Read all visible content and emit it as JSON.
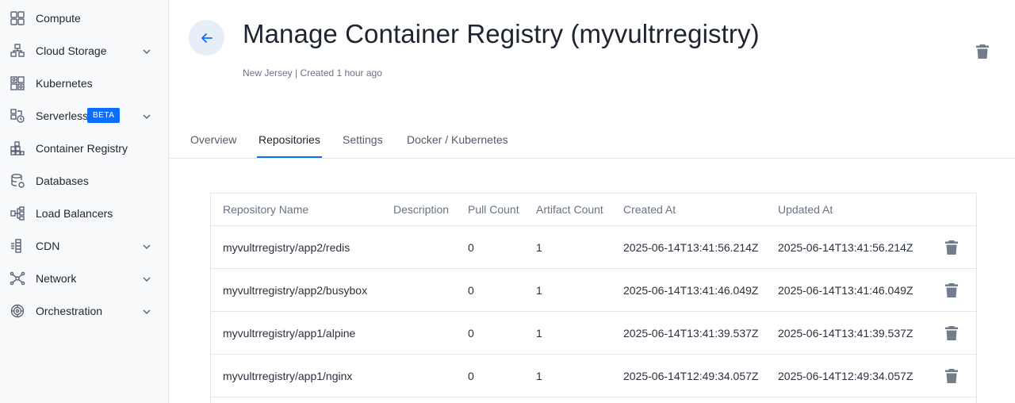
{
  "sidebar": {
    "items": [
      {
        "label": "Compute",
        "icon": "compute-icon",
        "expandable": false
      },
      {
        "label": "Cloud Storage",
        "icon": "cloud-storage-icon",
        "expandable": true
      },
      {
        "label": "Kubernetes",
        "icon": "kubernetes-icon",
        "expandable": false
      },
      {
        "label": "Serverless",
        "icon": "serverless-icon",
        "expandable": true,
        "badge": "BETA"
      },
      {
        "label": "Container Registry",
        "icon": "container-registry-icon",
        "expandable": false
      },
      {
        "label": "Databases",
        "icon": "databases-icon",
        "expandable": false
      },
      {
        "label": "Load Balancers",
        "icon": "load-balancers-icon",
        "expandable": false
      },
      {
        "label": "CDN",
        "icon": "cdn-icon",
        "expandable": true
      },
      {
        "label": "Network",
        "icon": "network-icon",
        "expandable": true
      },
      {
        "label": "Orchestration",
        "icon": "orchestration-icon",
        "expandable": true
      }
    ]
  },
  "header": {
    "title": "Manage Container Registry (myvultrregistry)",
    "subtitle": "New Jersey | Created 1 hour ago",
    "back_icon": "arrow-left-icon",
    "delete_icon": "trash-icon"
  },
  "tabs": [
    {
      "label": "Overview",
      "active": false
    },
    {
      "label": "Repositories",
      "active": true
    },
    {
      "label": "Settings",
      "active": false
    },
    {
      "label": "Docker / Kubernetes",
      "active": false
    }
  ],
  "table": {
    "columns": [
      "Repository Name",
      "Description",
      "Pull Count",
      "Artifact Count",
      "Created At",
      "Updated At"
    ],
    "rows": [
      {
        "name": "myvultrregistry/app2/redis",
        "description": "",
        "pull_count": "0",
        "artifact_count": "1",
        "created_at": "2025-06-14T13:41:56.214Z",
        "updated_at": "2025-06-14T13:41:56.214Z"
      },
      {
        "name": "myvultrregistry/app2/busybox",
        "description": "",
        "pull_count": "0",
        "artifact_count": "1",
        "created_at": "2025-06-14T13:41:46.049Z",
        "updated_at": "2025-06-14T13:41:46.049Z"
      },
      {
        "name": "myvultrregistry/app1/alpine",
        "description": "",
        "pull_count": "0",
        "artifact_count": "1",
        "created_at": "2025-06-14T13:41:39.537Z",
        "updated_at": "2025-06-14T13:41:39.537Z"
      },
      {
        "name": "myvultrregistry/app1/nginx",
        "description": "",
        "pull_count": "0",
        "artifact_count": "1",
        "created_at": "2025-06-14T12:49:34.057Z",
        "updated_at": "2025-06-14T12:49:34.057Z"
      }
    ]
  },
  "colors": {
    "accent": "#0d6efd",
    "sidebar_bg": "#f8f9fb",
    "icon_gray": "#5b6475",
    "trash_gray": "#747d8c"
  }
}
